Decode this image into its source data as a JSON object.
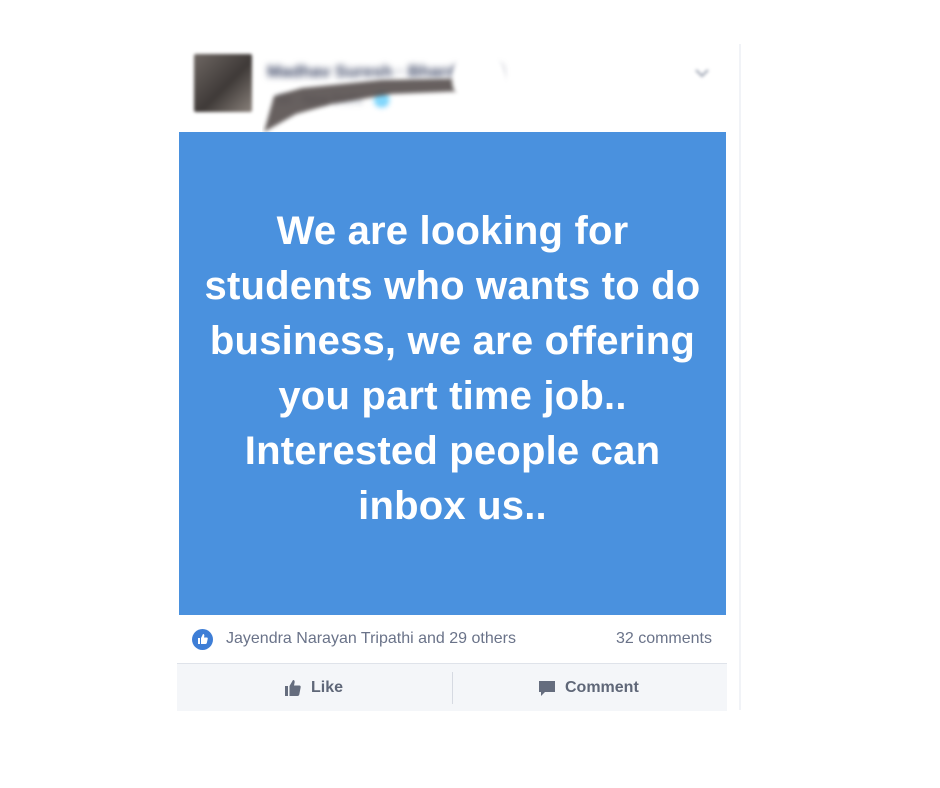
{
  "post": {
    "author": {
      "name": "Madhav Suresh · Bhardwaj Ji",
      "meta": "5h · New Delhi · 🌐"
    },
    "message": "We are looking for students who wants to do business, we are offering you part time job.. Interested people can inbox us..",
    "background_color": "#4a91de"
  },
  "reactions": {
    "names": "Jayendra Narayan Tripathi and 29 others",
    "comments": "32 comments"
  },
  "actions": {
    "like_label": "Like",
    "comment_label": "Comment"
  },
  "icons": {
    "like_badge": "thumbs-up-icon",
    "like_button": "thumbs-up-icon",
    "comment_button": "speech-bubble-icon",
    "menu": "chevron-down-icon"
  }
}
